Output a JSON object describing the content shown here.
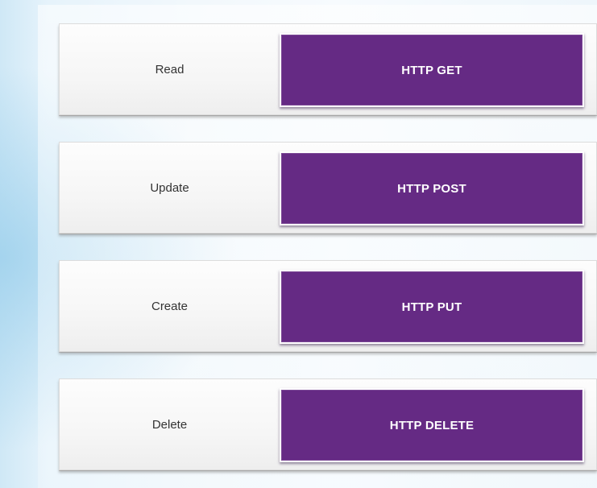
{
  "colors": {
    "accent": "#652a84",
    "row_background": "#f6f6f6",
    "label_text": "#333333",
    "button_text": "#ffffff"
  },
  "mappings": [
    {
      "operation": "Read",
      "method": "HTTP GET"
    },
    {
      "operation": "Update",
      "method": "HTTP POST"
    },
    {
      "operation": "Create",
      "method": "HTTP PUT"
    },
    {
      "operation": "Delete",
      "method": "HTTP DELETE"
    }
  ]
}
